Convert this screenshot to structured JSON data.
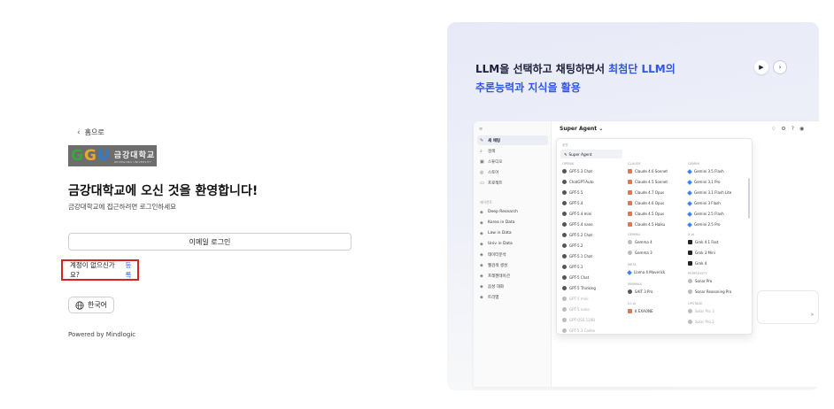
{
  "left": {
    "back_label": "홈으로",
    "logo": {
      "mark": "GGU",
      "korean": "금강대학교",
      "english": "GEUMGANG UNIVERSITY"
    },
    "welcome": "금강대학교에 오신 것을 환영합니다!",
    "subtitle": "금강대학교에 접근하려면 로그인하세요",
    "email_button": "이메일 로그인",
    "signup_prompt": "계정이 없으신가요?",
    "signup_link": "등록",
    "language_button": "한국어",
    "powered_by": "Powered by Mindlogic"
  },
  "right": {
    "hero_line1_a": "LLM을 선택하고 채팅하면서 ",
    "hero_line1_b": "최첨단 LLM의",
    "hero_line2": "추론능력과 지식을 활용",
    "accent": "#3156e6",
    "preview": {
      "topbar_title": "Super Agent ⌄",
      "sidebar_items": [
        "새 채팅",
        "검색",
        "스튜디오",
        "스토어",
        "프로젝트"
      ],
      "sidebar_section": "에이전트",
      "agent_items": [
        "Deep Research",
        "Korea in Data",
        "Law in Data",
        "Univ in Data",
        "데이터분석",
        "웹검색 생성",
        "프레젠테이션",
        "음성 대화",
        "트리맵"
      ],
      "dropdown": {
        "top_label": "추천",
        "selected": "Super Agent",
        "col1_label": "OPENAI",
        "col1": [
          "GPT-5.3 Chat",
          "ChatGPT-Auto",
          "GPT-5.5",
          "GPT-5.4",
          "GPT-5.4 mini",
          "GPT-5.4 nano",
          "GPT-5.2 Chat",
          "GPT-5.2",
          "GPT-5.1 Chat",
          "GPT-5.1",
          "GPT-5 Chat",
          "GPT-5 Thinking",
          "GPT-5 mini",
          "GPT-5 nano",
          "GPT-OSS 120B",
          "GPT-5.3 Codex"
        ],
        "col2_label": "CLAUDE",
        "col2": [
          "Claude 4.6 Sonnet",
          "Claude 4.5 Sonnet",
          "Claude 4.7 Opus",
          "Claude 4.6 Opus",
          "Claude 4.5 Opus",
          "Claude 4.5 Haiku"
        ],
        "col2b_label": "GEMMA",
        "col2b": [
          "Gemma 4",
          "Gemma 3"
        ],
        "col2c_label": "META",
        "col2c": [
          "Llama 4 Maverick"
        ],
        "col2d_label": "MINIMAX",
        "col2d": [
          "SAIT 3 Pro"
        ],
        "col2e_label": "LG AI",
        "col2e": [
          "K EXAONE"
        ],
        "col3_label": "GEMINI",
        "col3": [
          "Gemini 3.5 Flash",
          "Gemini 3.1 Pro",
          "Gemini 3.1 Flash Lite",
          "Gemini 3 Flash",
          "Gemini 2.5 Flash",
          "Gemini 2.5 Pro"
        ],
        "col3b_label": "X AI",
        "col3b": [
          "Grok 4.1 Fast",
          "Grok 3 Mini",
          "Grok 4"
        ],
        "col3c_label": "PERPLEXITY",
        "col3c": [
          "Sonar Pro",
          "Sonar Reasoning Pro"
        ],
        "col3d_label": "UPSTAGE",
        "col3d": [
          "Solar Pro 3",
          "Solar Pro 2"
        ]
      }
    }
  }
}
